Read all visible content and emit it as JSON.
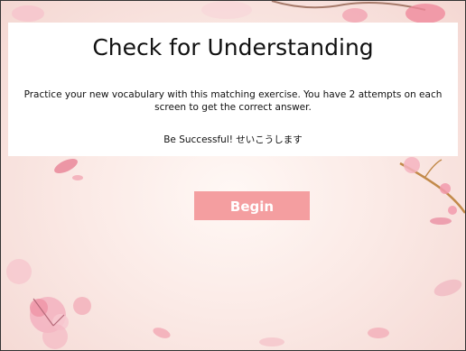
{
  "header": {
    "title": "Check for Understanding",
    "description": "Practice your new vocabulary with this matching exercise. You have 2 attempts on each screen to get the correct answer.",
    "success_message": "Be Successful! せいこうします"
  },
  "actions": {
    "begin_label": "Begin"
  },
  "colors": {
    "button": "#f49ea0",
    "blossom": "#f2a7b4",
    "background": "#fbeae6"
  },
  "decorations": [
    "cherry-blossom-icon"
  ]
}
